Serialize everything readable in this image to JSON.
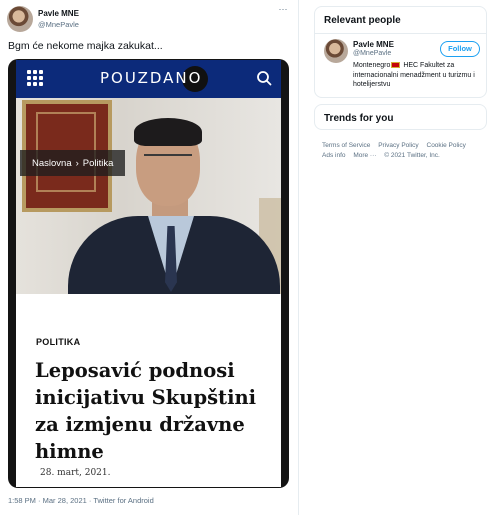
{
  "tweet": {
    "author_name": "Pavle MNE",
    "author_handle": "@MnePavle",
    "more_glyph": "···",
    "text": "Bgm će nekome majka zakukat...",
    "meta": "1:58 PM · Mar 28, 2021 · Twitter for Android"
  },
  "article": {
    "site_logo": "POUZDANO",
    "breadcrumb_home": "Naslovna",
    "breadcrumb_sep": "›",
    "breadcrumb_section": "Politika",
    "category": "POLITIKA",
    "headline": "Leposavić podnosi inicijativu Skupštini za izmjenu državne himne",
    "date": "28. mart, 2021."
  },
  "relevant_people": {
    "title": "Relevant people",
    "name": "Pavle MNE",
    "handle": "@MnePavle",
    "bio_before_flag": "Montenegro",
    "bio_after_flag": "HEC Fakultet za internacionalni menadžment u turizmu i hotelijerstvu",
    "follow_label": "Follow"
  },
  "trends": {
    "title": "Trends for you"
  },
  "footer": {
    "links": [
      "Terms of Service",
      "Privacy Policy",
      "Cookie Policy",
      "Ads info",
      "More ···",
      "© 2021 Twitter, Inc."
    ]
  },
  "colors": {
    "accent": "#1da1f2",
    "site_bar": "#0c2a7a"
  }
}
